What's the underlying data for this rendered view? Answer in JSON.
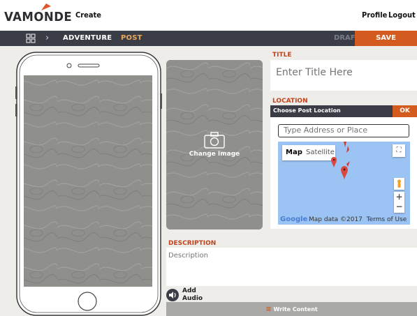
{
  "header": {
    "logo_text": "VAMONDE",
    "create_label": "Create",
    "profile_label": "Profile",
    "logout_label": "Logout"
  },
  "breadcrumb": {
    "items": [
      "ADVENTURE",
      "POST"
    ]
  },
  "actions": {
    "draft_label": "DRAFT",
    "save_label": "SAVE"
  },
  "media": {
    "change_image_label": "Change Image"
  },
  "title_section": {
    "label": "TITLE",
    "placeholder": "Enter Title Here"
  },
  "location_section": {
    "label": "LOCATION",
    "header": "Choose Post Location",
    "ok_label": "OK",
    "address_placeholder": "Type Address or Place",
    "map": {
      "tabs": [
        "Map",
        "Satellite"
      ],
      "active_tab": "Map",
      "google_label": "Google",
      "footer": "Map data ©2017  Terms of Use"
    }
  },
  "description_section": {
    "label": "DESCRIPTION",
    "placeholder": "Description"
  },
  "audio": {
    "label_line1": "Add",
    "label_line2": "Audio"
  },
  "footer": {
    "write_label": "Write Content"
  },
  "colors": {
    "accent": "#d35b1f",
    "dark_bar": "#3a3d46",
    "label_orange": "#c0441b",
    "map_water": "#9bc3f3",
    "background": "#efedea"
  }
}
